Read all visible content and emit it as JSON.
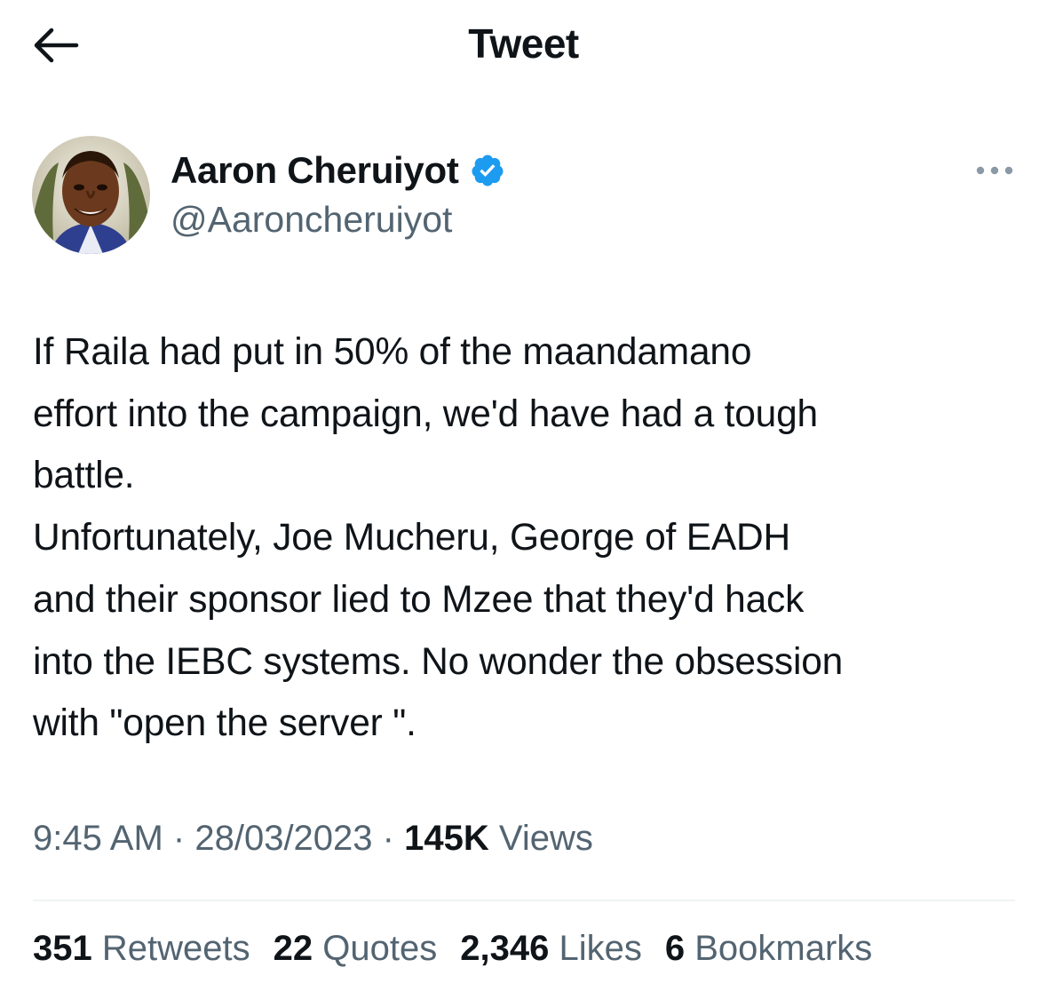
{
  "header": {
    "title": "Tweet",
    "back_icon": "arrow-left-icon"
  },
  "author": {
    "name": "Aaron Cheruiyot",
    "handle": "@Aaroncheruiyot",
    "verified_icon": "verified-badge-icon",
    "verified_color": "#1d9bf0"
  },
  "more_icon": "more-horizontal-icon",
  "tweet": {
    "text": "If Raila had put in 50% of the maandamano\neffort into the campaign, we'd have had a tough\nbattle.\nUnfortunately, Joe Mucheru, George of EADH\nand their sponsor lied to Mzee that they'd hack\ninto the IEBC systems. No wonder the obsession\nwith \"open the server \".",
    "time": "9:45 AM",
    "separator": "·",
    "date": "28/03/2023",
    "views_count": "145K",
    "views_label": "Views"
  },
  "stats": [
    {
      "count": "351",
      "label": "Retweets"
    },
    {
      "count": "22",
      "label": "Quotes"
    },
    {
      "count": "2,346",
      "label": "Likes"
    },
    {
      "count": "6",
      "label": "Bookmarks"
    }
  ],
  "colors": {
    "text_primary": "#0f1419",
    "text_secondary": "#536471",
    "divider": "#eff3f4"
  }
}
